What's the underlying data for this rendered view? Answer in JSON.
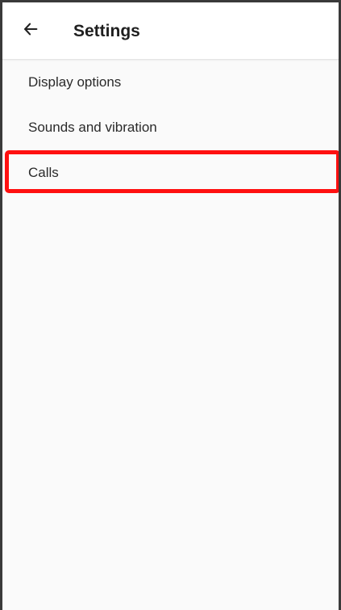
{
  "header": {
    "back_icon": "arrow-left-icon",
    "title": "Settings"
  },
  "menu": {
    "items": [
      {
        "label": "Display options"
      },
      {
        "label": "Sounds and vibration"
      },
      {
        "label": "Calls"
      }
    ]
  },
  "highlight": {
    "target": "Calls",
    "color": "#ff1010"
  }
}
